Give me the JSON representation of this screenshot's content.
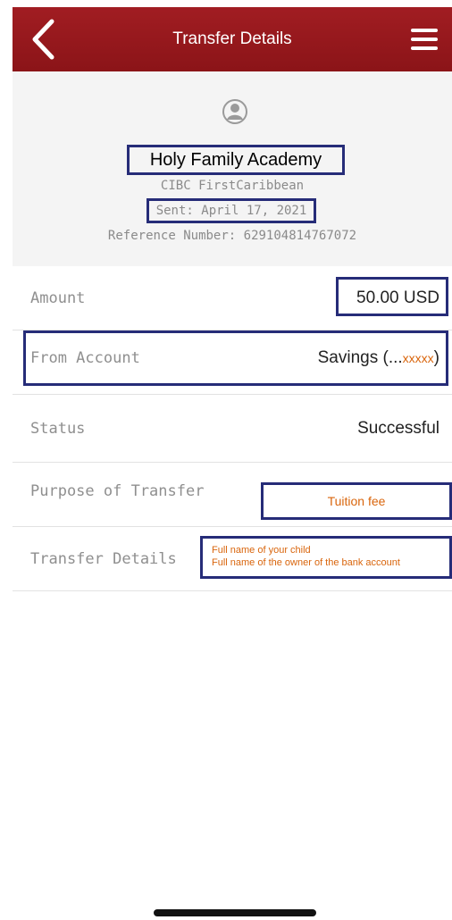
{
  "header": {
    "title": "Transfer Details",
    "back_icon": "chevron-left-icon",
    "menu_icon": "hamburger-menu-icon",
    "bg_color": "#8f151a"
  },
  "summary": {
    "avatar_icon": "user-avatar-icon",
    "payee_name": "Holy Family Academy",
    "bank_name": "CIBC FirstCaribbean",
    "sent_date": "Sent: April 17, 2021",
    "reference": "Reference Number: 629104814767072"
  },
  "details": {
    "amount": {
      "label": "Amount",
      "value": "50.00 USD"
    },
    "from_account": {
      "label": "From Account",
      "value_prefix": "Savings (...",
      "value_masked": "xxxxx",
      "value_suffix": " )"
    },
    "status": {
      "label": "Status",
      "value": "Successful"
    },
    "purpose": {
      "label": "Purpose of Transfer",
      "value": "Tuition fee"
    },
    "transfer_details": {
      "label": "Transfer Details",
      "line1": "Full name of your child",
      "line2": "Full name of the owner of the bank account"
    }
  },
  "colors": {
    "highlight_border": "#262c78",
    "annotation_text": "#d9650c"
  }
}
